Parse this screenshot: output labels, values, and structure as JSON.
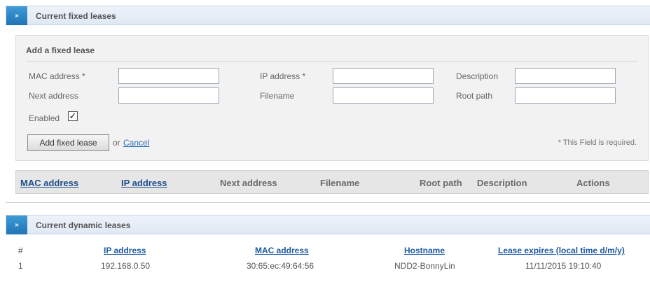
{
  "fixed_panel": {
    "title": "Current fixed leases",
    "toggle_glyph": "»"
  },
  "add_form": {
    "title": "Add a fixed lease",
    "labels": {
      "mac": "MAC address *",
      "ip": "IP address *",
      "description": "Description",
      "next": "Next address",
      "filename": "Filename",
      "root": "Root path",
      "enabled": "Enabled"
    },
    "values": {
      "mac": "",
      "ip": "",
      "description": "",
      "next": "",
      "filename": "",
      "root": ""
    },
    "enabled_checked": "✓",
    "add_button": "Add fixed lease",
    "or_text": "or",
    "cancel_link": "Cancel",
    "required_note": "* This Field is required."
  },
  "fixed_table": {
    "headers": [
      "MAC address",
      "IP address",
      "Next address",
      "Filename",
      "Root path",
      "Description",
      "Actions"
    ]
  },
  "dynamic_panel": {
    "title": "Current dynamic leases",
    "toggle_glyph": "»",
    "headers": [
      "#",
      "IP address",
      "MAC address",
      "Hostname",
      "Lease expires (local time d/m/y)"
    ],
    "rows": [
      [
        "1",
        "192.168.0.50",
        "30:65:ec:49:64:56",
        "NDD2-BonnyLin",
        "11/11/2015 19:10:40"
      ]
    ]
  },
  "colors": {
    "accent": "#1f74b5",
    "link": "#2b6fb6"
  },
  "icons": {
    "expand": "double-chevron-right-icon",
    "checkbox": "checkbox-checked-icon"
  }
}
